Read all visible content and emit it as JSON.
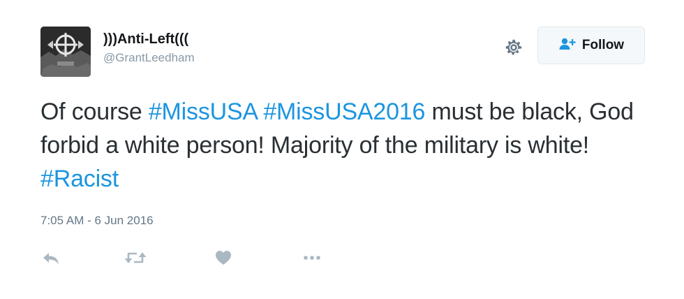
{
  "author": {
    "display_name": ")))Anti-Left(((",
    "handle": "@GrantLeedham"
  },
  "header": {
    "settings_icon": "gear-icon",
    "follow_button": {
      "icon": "add-user-icon",
      "label": "Follow"
    }
  },
  "tweet": {
    "segments": [
      {
        "text": "Of course ",
        "type": "text"
      },
      {
        "text": "#MissUSA",
        "type": "hashtag"
      },
      {
        "text": " ",
        "type": "text"
      },
      {
        "text": "#MissUSA2016",
        "type": "hashtag"
      },
      {
        "text": " must be black, God forbid a white person! Majority of the military is white! ",
        "type": "text"
      },
      {
        "text": "#Racist",
        "type": "hashtag"
      }
    ],
    "timestamp": "7:05 AM - 6 Jun 2016"
  },
  "actions": [
    {
      "name": "reply-icon"
    },
    {
      "name": "retweet-icon"
    },
    {
      "name": "like-icon"
    },
    {
      "name": "more-icon"
    }
  ],
  "colors": {
    "hashtag": "#1b95e0",
    "handle": "#8899a6",
    "action_icon": "#aab8c2",
    "follow_icon": "#1b95e0"
  }
}
